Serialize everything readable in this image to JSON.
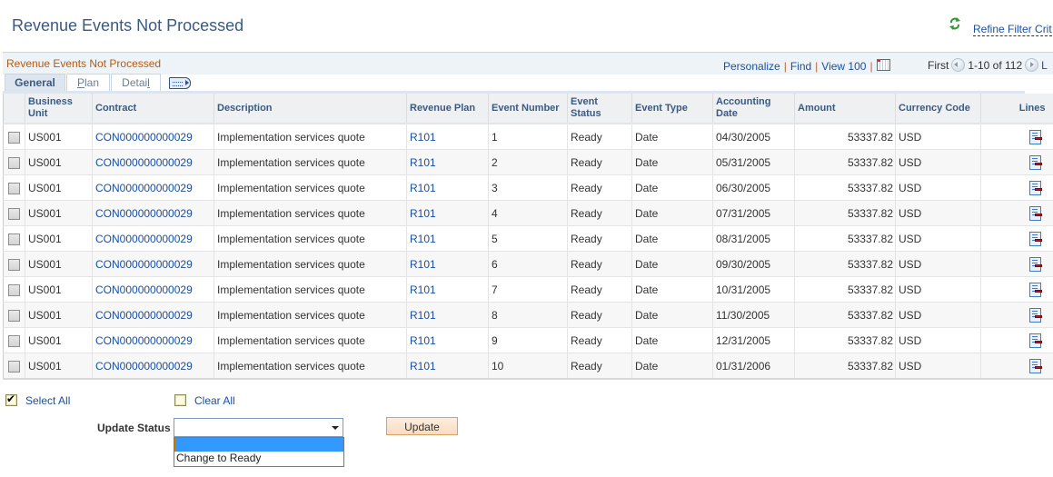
{
  "page": {
    "title": "Revenue Events Not Processed",
    "refine_filter_label": "Refine Filter Crit"
  },
  "grid": {
    "title": "Revenue Events Not Processed",
    "nav": {
      "personalize": "Personalize",
      "find": "Find",
      "view_100": "View 100",
      "first": "First",
      "range": "1-10 of 112",
      "last": "L"
    },
    "tabs": [
      {
        "label_pre": "General",
        "label_u": "",
        "label_post": "",
        "active": true
      },
      {
        "label_pre": "",
        "label_u": "P",
        "label_post": "lan",
        "active": false
      },
      {
        "label_pre": "Detai",
        "label_u": "l",
        "label_post": "",
        "active": false
      }
    ],
    "columns": [
      "",
      "Business Unit",
      "Contract",
      "Description",
      "Revenue Plan",
      "Event Number",
      "Event Status",
      "Event Type",
      "Accounting Date",
      "Amount",
      "Currency Code",
      "Lines"
    ],
    "rows": [
      {
        "business_unit": "US001",
        "contract": "CON000000000029",
        "description": "Implementation services quote",
        "revenue_plan": "R101",
        "event_number": "1",
        "event_status": "Ready",
        "event_type": "Date",
        "accounting_date": "04/30/2005",
        "amount": "53337.82",
        "currency": "USD",
        "selected": false
      },
      {
        "business_unit": "US001",
        "contract": "CON000000000029",
        "description": "Implementation services quote",
        "revenue_plan": "R101",
        "event_number": "2",
        "event_status": "Ready",
        "event_type": "Date",
        "accounting_date": "05/31/2005",
        "amount": "53337.82",
        "currency": "USD",
        "selected": false
      },
      {
        "business_unit": "US001",
        "contract": "CON000000000029",
        "description": "Implementation services quote",
        "revenue_plan": "R101",
        "event_number": "3",
        "event_status": "Ready",
        "event_type": "Date",
        "accounting_date": "06/30/2005",
        "amount": "53337.82",
        "currency": "USD",
        "selected": false
      },
      {
        "business_unit": "US001",
        "contract": "CON000000000029",
        "description": "Implementation services quote",
        "revenue_plan": "R101",
        "event_number": "4",
        "event_status": "Ready",
        "event_type": "Date",
        "accounting_date": "07/31/2005",
        "amount": "53337.82",
        "currency": "USD",
        "selected": false
      },
      {
        "business_unit": "US001",
        "contract": "CON000000000029",
        "description": "Implementation services quote",
        "revenue_plan": "R101",
        "event_number": "5",
        "event_status": "Ready",
        "event_type": "Date",
        "accounting_date": "08/31/2005",
        "amount": "53337.82",
        "currency": "USD",
        "selected": false
      },
      {
        "business_unit": "US001",
        "contract": "CON000000000029",
        "description": "Implementation services quote",
        "revenue_plan": "R101",
        "event_number": "6",
        "event_status": "Ready",
        "event_type": "Date",
        "accounting_date": "09/30/2005",
        "amount": "53337.82",
        "currency": "USD",
        "selected": false
      },
      {
        "business_unit": "US001",
        "contract": "CON000000000029",
        "description": "Implementation services quote",
        "revenue_plan": "R101",
        "event_number": "7",
        "event_status": "Ready",
        "event_type": "Date",
        "accounting_date": "10/31/2005",
        "amount": "53337.82",
        "currency": "USD",
        "selected": false
      },
      {
        "business_unit": "US001",
        "contract": "CON000000000029",
        "description": "Implementation services quote",
        "revenue_plan": "R101",
        "event_number": "8",
        "event_status": "Ready",
        "event_type": "Date",
        "accounting_date": "11/30/2005",
        "amount": "53337.82",
        "currency": "USD",
        "selected": false
      },
      {
        "business_unit": "US001",
        "contract": "CON000000000029",
        "description": "Implementation services quote",
        "revenue_plan": "R101",
        "event_number": "9",
        "event_status": "Ready",
        "event_type": "Date",
        "accounting_date": "12/31/2005",
        "amount": "53337.82",
        "currency": "USD",
        "selected": false
      },
      {
        "business_unit": "US001",
        "contract": "CON000000000029",
        "description": "Implementation services quote",
        "revenue_plan": "R101",
        "event_number": "10",
        "event_status": "Ready",
        "event_type": "Date",
        "accounting_date": "01/31/2006",
        "amount": "53337.82",
        "currency": "USD",
        "selected": false
      }
    ]
  },
  "controls": {
    "select_all": {
      "label": "Select All",
      "checked": true
    },
    "clear_all": {
      "label": "Clear All",
      "checked": false
    },
    "update_status_label": "Update Status",
    "update_status_value": "",
    "update_status_options": [
      "",
      "Change to Ready"
    ],
    "update_button": "Update"
  },
  "icons": {
    "refresh": "refresh-icon",
    "prev": "previous-page-icon",
    "next": "next-page-icon",
    "download": "calendar-grid-icon",
    "expand_tabs": "show-all-columns-icon",
    "lines": "lines-detail-icon"
  },
  "colors": {
    "title": "#3b5a82",
    "link": "#1a4fa0",
    "grid_title": "#b35b14",
    "dropdown_highlight": "#3399ff",
    "update_button_bg": "#f9dcc0"
  }
}
